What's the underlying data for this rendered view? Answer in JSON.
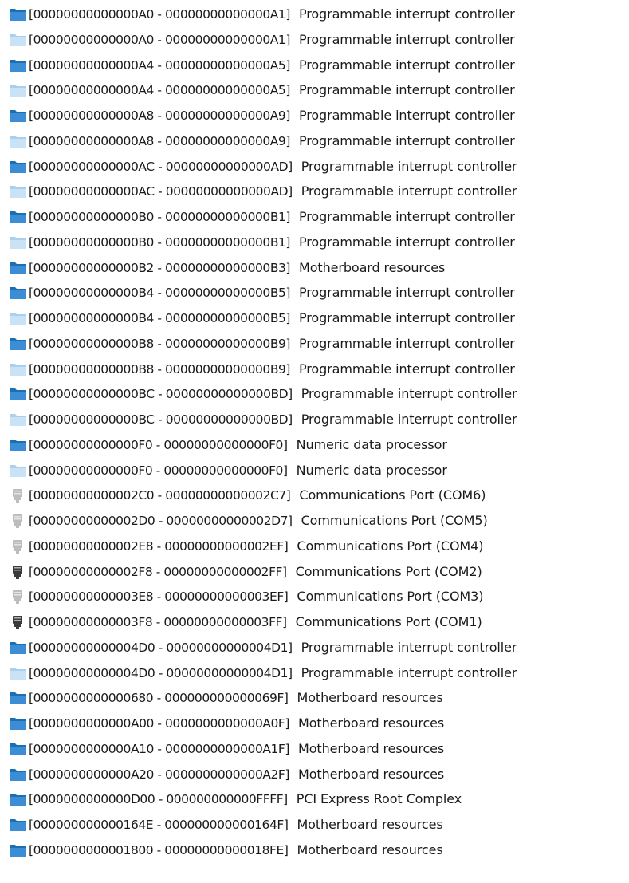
{
  "rows": [
    {
      "range": "[00000000000000A0 - 00000000000000A1]",
      "desc": "Programmable interrupt controller",
      "icon": "folder-icon"
    },
    {
      "range": "[00000000000000A0 - 00000000000000A1]",
      "desc": "Programmable interrupt controller",
      "icon": "folder-icon-faded"
    },
    {
      "range": "[00000000000000A4 - 00000000000000A5]",
      "desc": "Programmable interrupt controller",
      "icon": "folder-icon"
    },
    {
      "range": "[00000000000000A4 - 00000000000000A5]",
      "desc": "Programmable interrupt controller",
      "icon": "folder-icon-faded"
    },
    {
      "range": "[00000000000000A8 - 00000000000000A9]",
      "desc": "Programmable interrupt controller",
      "icon": "folder-icon"
    },
    {
      "range": "[00000000000000A8 - 00000000000000A9]",
      "desc": "Programmable interrupt controller",
      "icon": "folder-icon-faded"
    },
    {
      "range": "[00000000000000AC - 00000000000000AD]",
      "desc": "Programmable interrupt controller",
      "icon": "folder-icon"
    },
    {
      "range": "[00000000000000AC - 00000000000000AD]",
      "desc": "Programmable interrupt controller",
      "icon": "folder-icon-faded"
    },
    {
      "range": "[00000000000000B0 - 00000000000000B1]",
      "desc": "Programmable interrupt controller",
      "icon": "folder-icon"
    },
    {
      "range": "[00000000000000B0 - 00000000000000B1]",
      "desc": "Programmable interrupt controller",
      "icon": "folder-icon-faded"
    },
    {
      "range": "[00000000000000B2 - 00000000000000B3]",
      "desc": "Motherboard resources",
      "icon": "folder-icon"
    },
    {
      "range": "[00000000000000B4 - 00000000000000B5]",
      "desc": "Programmable interrupt controller",
      "icon": "folder-icon"
    },
    {
      "range": "[00000000000000B4 - 00000000000000B5]",
      "desc": "Programmable interrupt controller",
      "icon": "folder-icon-faded"
    },
    {
      "range": "[00000000000000B8 - 00000000000000B9]",
      "desc": "Programmable interrupt controller",
      "icon": "folder-icon"
    },
    {
      "range": "[00000000000000B8 - 00000000000000B9]",
      "desc": "Programmable interrupt controller",
      "icon": "folder-icon-faded"
    },
    {
      "range": "[00000000000000BC - 00000000000000BD]",
      "desc": "Programmable interrupt controller",
      "icon": "folder-icon"
    },
    {
      "range": "[00000000000000BC - 00000000000000BD]",
      "desc": "Programmable interrupt controller",
      "icon": "folder-icon-faded"
    },
    {
      "range": "[00000000000000F0 - 00000000000000F0]",
      "desc": "Numeric data processor",
      "icon": "folder-icon"
    },
    {
      "range": "[00000000000000F0 - 00000000000000F0]",
      "desc": "Numeric data processor",
      "icon": "folder-icon-faded"
    },
    {
      "range": "[00000000000002C0 - 00000000000002C7]",
      "desc": "Communications Port (COM6)",
      "icon": "serial-port-icon-faded"
    },
    {
      "range": "[00000000000002D0 - 00000000000002D7]",
      "desc": "Communications Port (COM5)",
      "icon": "serial-port-icon-faded"
    },
    {
      "range": "[00000000000002E8 - 00000000000002EF]",
      "desc": "Communications Port (COM4)",
      "icon": "serial-port-icon-faded"
    },
    {
      "range": "[00000000000002F8 - 00000000000002FF]",
      "desc": "Communications Port (COM2)",
      "icon": "serial-port-icon"
    },
    {
      "range": "[00000000000003E8 - 00000000000003EF]",
      "desc": "Communications Port (COM3)",
      "icon": "serial-port-icon-faded"
    },
    {
      "range": "[00000000000003F8 - 00000000000003FF]",
      "desc": "Communications Port (COM1)",
      "icon": "serial-port-icon"
    },
    {
      "range": "[00000000000004D0 - 00000000000004D1]",
      "desc": "Programmable interrupt controller",
      "icon": "folder-icon"
    },
    {
      "range": "[00000000000004D0 - 00000000000004D1]",
      "desc": "Programmable interrupt controller",
      "icon": "folder-icon-faded"
    },
    {
      "range": "[0000000000000680 - 000000000000069F]",
      "desc": "Motherboard resources",
      "icon": "folder-icon"
    },
    {
      "range": "[0000000000000A00 - 0000000000000A0F]",
      "desc": "Motherboard resources",
      "icon": "folder-icon"
    },
    {
      "range": "[0000000000000A10 - 0000000000000A1F]",
      "desc": "Motherboard resources",
      "icon": "folder-icon"
    },
    {
      "range": "[0000000000000A20 - 0000000000000A2F]",
      "desc": "Motherboard resources",
      "icon": "folder-icon"
    },
    {
      "range": "[0000000000000D00 - 000000000000FFFF]",
      "desc": "PCI Express Root Complex",
      "icon": "folder-icon"
    },
    {
      "range": "[000000000000164E - 000000000000164F]",
      "desc": "Motherboard resources",
      "icon": "folder-icon"
    },
    {
      "range": "[0000000000001800 - 00000000000018FE]",
      "desc": "Motherboard resources",
      "icon": "folder-icon"
    }
  ],
  "colors": {
    "folder_dark": "#1c6fb0",
    "folder_light": "#3b8ed6",
    "folder_faded": "#a9d0ee",
    "port_dark": "#3a3a3a",
    "port_faded": "#bdbdbd"
  }
}
